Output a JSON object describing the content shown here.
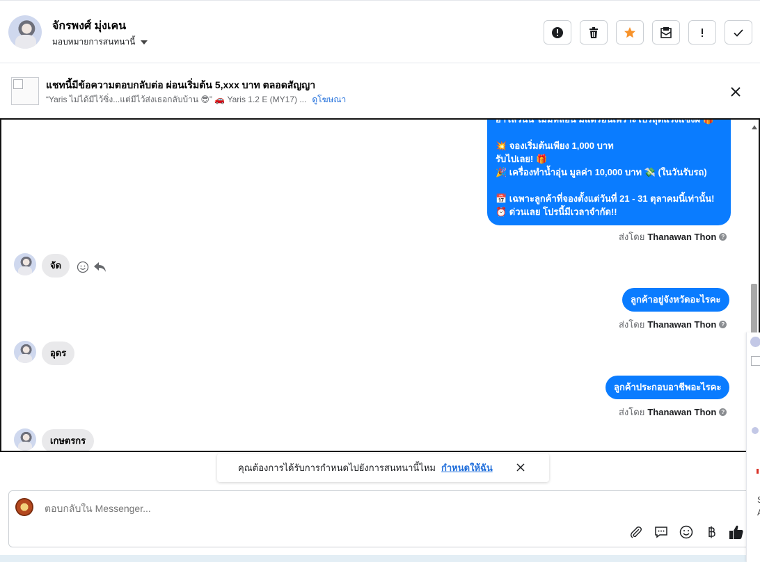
{
  "header": {
    "contact_name": "จักรพงศ์ มุ่งเคน",
    "assign_label": "มอบหมายการสนทนานี้",
    "actions": [
      "report-icon",
      "trash-icon",
      "star-icon",
      "mark-unread-icon",
      "important-icon",
      "check-icon"
    ]
  },
  "ad": {
    "title": "แชทนี้มีข้อความตอบกลับต่อ ผ่อนเริ่มต้น 5,xxx บาท ตลอดสัญญา",
    "subtitle": "“Yaris ไม่ได้มีไว้ซิ่ง...แต่มีไว้ส่งเธอกลับบ้าน 😎” 🚗 Yaris 1.2 E (MY17) ...",
    "link": "ดูโฆษณา"
  },
  "chat": {
    "big_message_lines": [
      "ฮาโลวีนนี้ ไม่มีหลอน มีแต่ร้อนเพราะโปรสุดแรงแซงผี 🎁",
      "",
      "💥 จองเริ่มต้นเพียง 1,000 บาท",
      "รับไปเลย! 🎁",
      "🎉 เครื่องทำน้ำอุ่น มูลค่า 10,000 บาท 💸 (ในวันรับรถ)",
      "",
      "📅 เฉพาะลูกค้าที่จองตั้งแต่วันที่ 21 - 31 ตุลาคมนี้เท่านั้น!",
      "⏰ ด่วนเลย โปรนี้มีเวลาจำกัด!!"
    ],
    "sent_prefix": "ส่งโดย",
    "agent_name": "Thanawan Thon",
    "incoming_1": "จัด",
    "outgoing_1": "ลูกค้าอยู่จังหวัดอะไรคะ",
    "incoming_2": "อุดร",
    "outgoing_2": "ลูกค้าประกอบอาชีพอะไรคะ",
    "incoming_3": "เกษตรกร"
  },
  "prompt": {
    "text": "คุณต้องการได้รับการกำหนดไปยังการสนทนานี้ไหม",
    "link": "กำหนดให้ฉัน"
  },
  "composer": {
    "placeholder": "ตอบกลับใน Messenger...",
    "tools": [
      "attach-icon",
      "saved-reply-icon",
      "emoji-icon",
      "baht-icon",
      "like-icon"
    ]
  },
  "right_panel": {
    "letters": [
      "S",
      "A"
    ]
  },
  "colors": {
    "accent": "#0a7cff",
    "link": "#216fdb",
    "star": "#f7922a"
  }
}
